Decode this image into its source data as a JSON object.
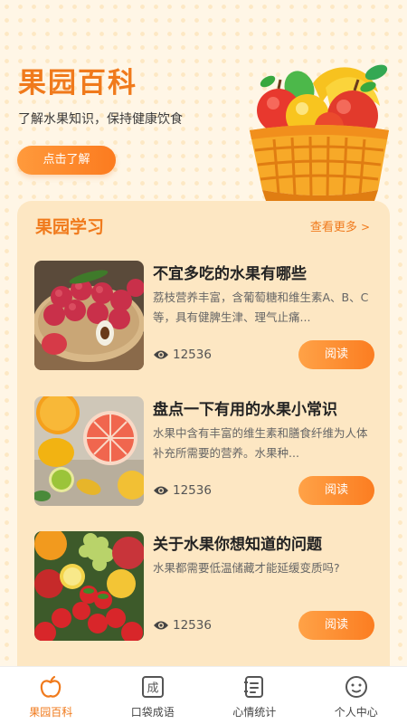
{
  "hero": {
    "title": "果园百科",
    "subtitle": "了解水果知识，保持健康饮食",
    "button": "点击了解"
  },
  "section": {
    "title": "果园学习",
    "more": "查看更多",
    "articles": [
      {
        "title": "不宜多吃的水果有哪些",
        "desc": "荔枝营养丰富，含葡萄糖和维生素A、B、C等，具有健脾生津、理气止痛...",
        "views": "12536",
        "button": "阅读"
      },
      {
        "title": "盘点一下有用的水果小常识",
        "desc": "水果中含有丰富的维生素和膳食纤维为人体补充所需要的营养。水果种...",
        "views": "12536",
        "button": "阅读"
      },
      {
        "title": "关于水果你想知道的问题",
        "desc": "水果都需要低温储藏才能延缓变质吗?",
        "views": "12536",
        "button": "阅读"
      }
    ]
  },
  "tabs": [
    {
      "label": "果园百科",
      "icon": "apple-icon",
      "active": true
    },
    {
      "label": "口袋成语",
      "icon": "idiom-icon",
      "active": false
    },
    {
      "label": "心情统计",
      "icon": "notes-icon",
      "active": false
    },
    {
      "label": "个人中心",
      "icon": "smiley-icon",
      "active": false
    }
  ],
  "colors": {
    "accent": "#f07a1c",
    "panel": "#fde7c3",
    "background": "#fff6e6"
  }
}
